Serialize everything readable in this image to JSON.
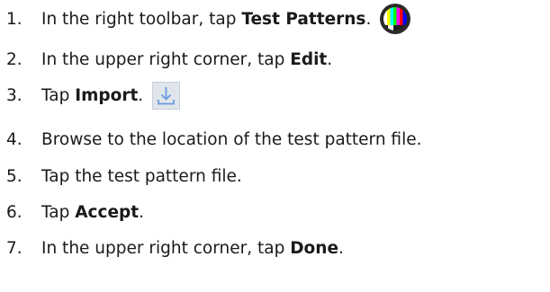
{
  "steps": [
    {
      "num": "1.",
      "before": "In the right toolbar, tap ",
      "bold": "Test Patterns",
      "after": ".",
      "icon": "test-patterns-icon"
    },
    {
      "num": "2.",
      "before": "In the upper right corner, tap ",
      "bold": "Edit",
      "after": "."
    },
    {
      "num": "3.",
      "before": "Tap ",
      "bold": "Import",
      "after": ".",
      "icon": "import-icon"
    },
    {
      "num": "4.",
      "before": "Browse to the location of the test pattern file.",
      "bold": "",
      "after": ""
    },
    {
      "num": "5.",
      "before": "Tap the test pattern file.",
      "bold": "",
      "after": ""
    },
    {
      "num": "6.",
      "before": "Tap ",
      "bold": "Accept",
      "after": "."
    },
    {
      "num": "7.",
      "before": "In the upper right corner, tap ",
      "bold": "Done",
      "after": "."
    }
  ]
}
